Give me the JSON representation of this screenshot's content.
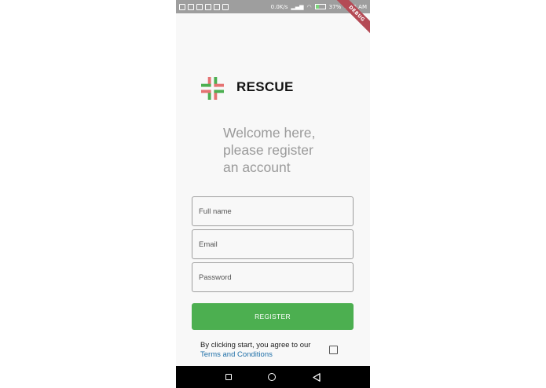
{
  "status_bar": {
    "network_speed": "0.0K/s",
    "battery_percent": "37%",
    "time": "9:35 AM"
  },
  "debug_ribbon": "DEBUG",
  "app": {
    "title": "RESCUE",
    "logo_colors": {
      "primary": "#4caf50",
      "secondary": "#e57373"
    }
  },
  "welcome_text": "Welcome here,\nplease register\nan account",
  "form": {
    "full_name_placeholder": "Full name",
    "email_placeholder": "Email",
    "password_placeholder": "Password",
    "register_label": "REGISTER"
  },
  "terms": {
    "prefix": "By clicking start, you agree to our ",
    "link_label": "Terms and Conditions",
    "checked": false
  },
  "colors": {
    "accent": "#4caf50",
    "link": "#1e6fa8",
    "welcome_text": "#9a9a9a"
  },
  "nav_bar": {
    "icons": [
      "recents-icon",
      "home-icon",
      "back-icon"
    ]
  }
}
